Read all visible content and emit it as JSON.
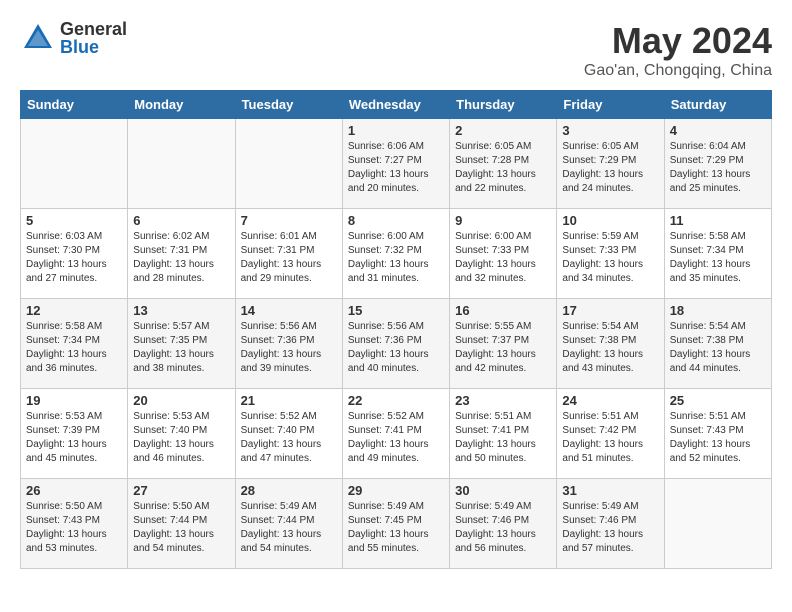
{
  "header": {
    "logo_general": "General",
    "logo_blue": "Blue",
    "month_title": "May 2024",
    "location": "Gao'an, Chongqing, China"
  },
  "weekdays": [
    "Sunday",
    "Monday",
    "Tuesday",
    "Wednesday",
    "Thursday",
    "Friday",
    "Saturday"
  ],
  "weeks": [
    [
      {
        "day": "",
        "info": ""
      },
      {
        "day": "",
        "info": ""
      },
      {
        "day": "",
        "info": ""
      },
      {
        "day": "1",
        "info": "Sunrise: 6:06 AM\nSunset: 7:27 PM\nDaylight: 13 hours\nand 20 minutes."
      },
      {
        "day": "2",
        "info": "Sunrise: 6:05 AM\nSunset: 7:28 PM\nDaylight: 13 hours\nand 22 minutes."
      },
      {
        "day": "3",
        "info": "Sunrise: 6:05 AM\nSunset: 7:29 PM\nDaylight: 13 hours\nand 24 minutes."
      },
      {
        "day": "4",
        "info": "Sunrise: 6:04 AM\nSunset: 7:29 PM\nDaylight: 13 hours\nand 25 minutes."
      }
    ],
    [
      {
        "day": "5",
        "info": "Sunrise: 6:03 AM\nSunset: 7:30 PM\nDaylight: 13 hours\nand 27 minutes."
      },
      {
        "day": "6",
        "info": "Sunrise: 6:02 AM\nSunset: 7:31 PM\nDaylight: 13 hours\nand 28 minutes."
      },
      {
        "day": "7",
        "info": "Sunrise: 6:01 AM\nSunset: 7:31 PM\nDaylight: 13 hours\nand 29 minutes."
      },
      {
        "day": "8",
        "info": "Sunrise: 6:00 AM\nSunset: 7:32 PM\nDaylight: 13 hours\nand 31 minutes."
      },
      {
        "day": "9",
        "info": "Sunrise: 6:00 AM\nSunset: 7:33 PM\nDaylight: 13 hours\nand 32 minutes."
      },
      {
        "day": "10",
        "info": "Sunrise: 5:59 AM\nSunset: 7:33 PM\nDaylight: 13 hours\nand 34 minutes."
      },
      {
        "day": "11",
        "info": "Sunrise: 5:58 AM\nSunset: 7:34 PM\nDaylight: 13 hours\nand 35 minutes."
      }
    ],
    [
      {
        "day": "12",
        "info": "Sunrise: 5:58 AM\nSunset: 7:34 PM\nDaylight: 13 hours\nand 36 minutes."
      },
      {
        "day": "13",
        "info": "Sunrise: 5:57 AM\nSunset: 7:35 PM\nDaylight: 13 hours\nand 38 minutes."
      },
      {
        "day": "14",
        "info": "Sunrise: 5:56 AM\nSunset: 7:36 PM\nDaylight: 13 hours\nand 39 minutes."
      },
      {
        "day": "15",
        "info": "Sunrise: 5:56 AM\nSunset: 7:36 PM\nDaylight: 13 hours\nand 40 minutes."
      },
      {
        "day": "16",
        "info": "Sunrise: 5:55 AM\nSunset: 7:37 PM\nDaylight: 13 hours\nand 42 minutes."
      },
      {
        "day": "17",
        "info": "Sunrise: 5:54 AM\nSunset: 7:38 PM\nDaylight: 13 hours\nand 43 minutes."
      },
      {
        "day": "18",
        "info": "Sunrise: 5:54 AM\nSunset: 7:38 PM\nDaylight: 13 hours\nand 44 minutes."
      }
    ],
    [
      {
        "day": "19",
        "info": "Sunrise: 5:53 AM\nSunset: 7:39 PM\nDaylight: 13 hours\nand 45 minutes."
      },
      {
        "day": "20",
        "info": "Sunrise: 5:53 AM\nSunset: 7:40 PM\nDaylight: 13 hours\nand 46 minutes."
      },
      {
        "day": "21",
        "info": "Sunrise: 5:52 AM\nSunset: 7:40 PM\nDaylight: 13 hours\nand 47 minutes."
      },
      {
        "day": "22",
        "info": "Sunrise: 5:52 AM\nSunset: 7:41 PM\nDaylight: 13 hours\nand 49 minutes."
      },
      {
        "day": "23",
        "info": "Sunrise: 5:51 AM\nSunset: 7:41 PM\nDaylight: 13 hours\nand 50 minutes."
      },
      {
        "day": "24",
        "info": "Sunrise: 5:51 AM\nSunset: 7:42 PM\nDaylight: 13 hours\nand 51 minutes."
      },
      {
        "day": "25",
        "info": "Sunrise: 5:51 AM\nSunset: 7:43 PM\nDaylight: 13 hours\nand 52 minutes."
      }
    ],
    [
      {
        "day": "26",
        "info": "Sunrise: 5:50 AM\nSunset: 7:43 PM\nDaylight: 13 hours\nand 53 minutes."
      },
      {
        "day": "27",
        "info": "Sunrise: 5:50 AM\nSunset: 7:44 PM\nDaylight: 13 hours\nand 54 minutes."
      },
      {
        "day": "28",
        "info": "Sunrise: 5:49 AM\nSunset: 7:44 PM\nDaylight: 13 hours\nand 54 minutes."
      },
      {
        "day": "29",
        "info": "Sunrise: 5:49 AM\nSunset: 7:45 PM\nDaylight: 13 hours\nand 55 minutes."
      },
      {
        "day": "30",
        "info": "Sunrise: 5:49 AM\nSunset: 7:46 PM\nDaylight: 13 hours\nand 56 minutes."
      },
      {
        "day": "31",
        "info": "Sunrise: 5:49 AM\nSunset: 7:46 PM\nDaylight: 13 hours\nand 57 minutes."
      },
      {
        "day": "",
        "info": ""
      }
    ]
  ]
}
